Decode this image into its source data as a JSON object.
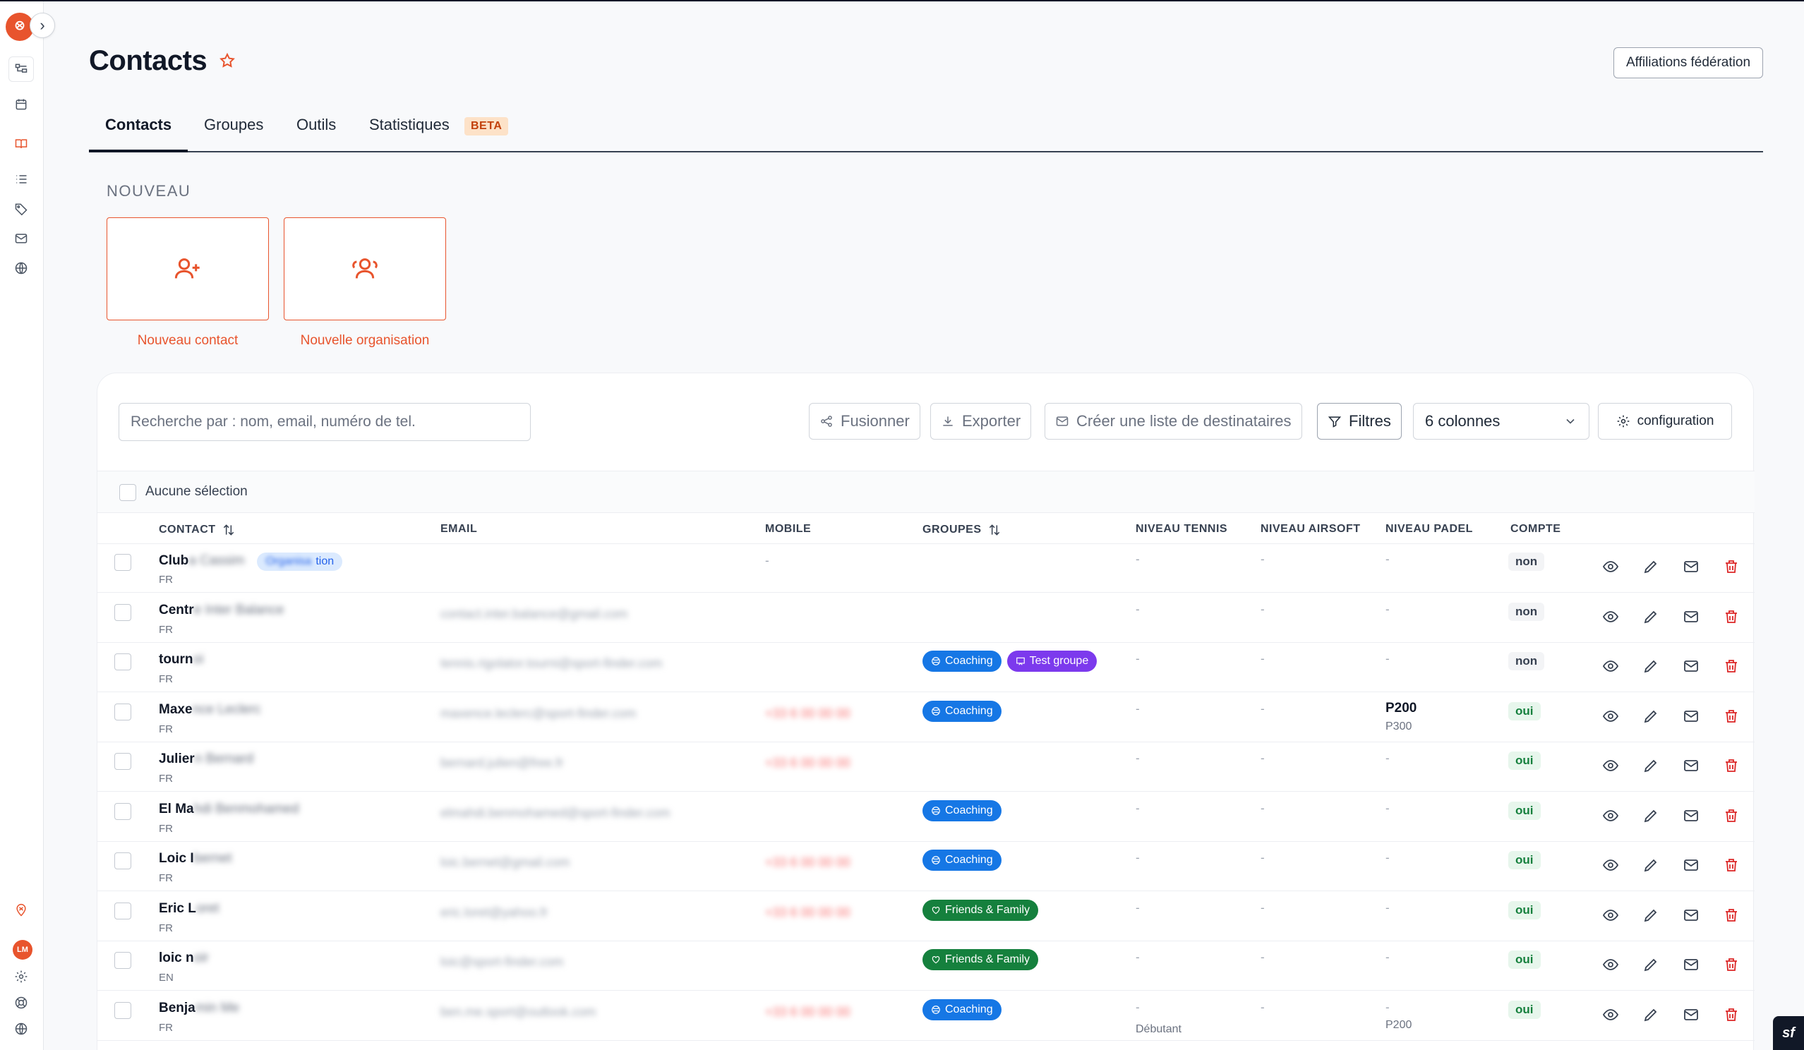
{
  "page": {
    "title": "Contacts",
    "affiliations_button": "Affiliations fédération"
  },
  "user": {
    "initials": "LM"
  },
  "tabs": [
    {
      "label": "Contacts",
      "active": true
    },
    {
      "label": "Groupes"
    },
    {
      "label": "Outils"
    },
    {
      "label": "Statistiques",
      "badge": "BETA"
    }
  ],
  "nouveau": {
    "label": "NOUVEAU",
    "contact_label": "Nouveau contact",
    "organisation_label": "Nouvelle organisation"
  },
  "toolbar": {
    "search_placeholder": "Recherche par : nom, email, numéro de tel.",
    "merge": "Fusionner",
    "export": "Exporter",
    "create_list": "Créer une liste de destinataires",
    "filters": "Filtres",
    "columns_select": "6 colonnes",
    "configuration": "configuration"
  },
  "selection": {
    "label": "Aucune sélection"
  },
  "table": {
    "headers": {
      "contact": "CONTACT",
      "email": "EMAIL",
      "mobile": "MOBILE",
      "groupes": "GROUPES",
      "tennis": "NIVEAU TENNIS",
      "airsoft": "NIVEAU AIRSOFT",
      "padel": "NIVEAU PADEL",
      "compte": "COMPTE"
    },
    "dash": "-",
    "rows": [
      {
        "name": "Club",
        "name_blur": "a Cassim",
        "chip_extra": "tion",
        "lang": "FR",
        "email": "",
        "mobile": "-",
        "groups": [],
        "tennis": "-",
        "airsoft": "-",
        "padel": "-",
        "padel_sub": "",
        "tennis_sub": "",
        "compte": "non"
      },
      {
        "name": "Centr",
        "name_blur": "e Inter Balance",
        "lang": "FR",
        "email": "contact.inter.balance@gmail.com",
        "mobile": "",
        "groups": [],
        "tennis": "-",
        "airsoft": "-",
        "padel": "-",
        "padel_sub": "",
        "tennis_sub": "",
        "compte": "non"
      },
      {
        "name": "tourn",
        "name_blur": "oi",
        "lang": "FR",
        "email": "tennis.rigolator.tourni@sport-finder.com",
        "mobile": "",
        "groups": [
          "Coaching",
          "Test groupe"
        ],
        "tennis": "-",
        "airsoft": "-",
        "padel": "-",
        "padel_sub": "",
        "tennis_sub": "",
        "compte": "non"
      },
      {
        "name": "Maxe",
        "name_blur": "nce Leclerc",
        "lang": "FR",
        "email": "maxence.leclerc@sport-finder.com",
        "mobile": "+33 6 00 00 00",
        "groups": [
          "Coaching"
        ],
        "tennis": "-",
        "airsoft": "-",
        "padel": "P200",
        "padel_sub": "P300",
        "tennis_sub": "",
        "compte": "oui"
      },
      {
        "name": "Julier",
        "name_blur": "n Bernard",
        "lang": "FR",
        "email": "bernard.julien@free.fr",
        "mobile": "+33 6 00 00 00",
        "groups": [],
        "tennis": "-",
        "airsoft": "-",
        "padel": "-",
        "padel_sub": "",
        "tennis_sub": "",
        "compte": "oui"
      },
      {
        "name": "El Ma",
        "name_blur": "hdi Benmohamed",
        "lang": "FR",
        "email": "elmahdi.benmohamed@sport-finder.com",
        "mobile": "",
        "groups": [
          "Coaching"
        ],
        "tennis": "-",
        "airsoft": "-",
        "padel": "-",
        "padel_sub": "",
        "tennis_sub": "",
        "compte": "oui"
      },
      {
        "name": "Loic I",
        "name_blur": "bernet",
        "lang": "FR",
        "email": "loic.bernet@gmail.com",
        "mobile": "+33 6 00 00 00",
        "groups": [
          "Coaching"
        ],
        "tennis": "-",
        "airsoft": "-",
        "padel": "-",
        "padel_sub": "",
        "tennis_sub": "",
        "compte": "oui"
      },
      {
        "name": "Eric L",
        "name_blur": "oret",
        "lang": "FR",
        "email": "eric.loret@yahoo.fr",
        "mobile": "+33 6 00 00 00",
        "groups": [
          "Friends & Family"
        ],
        "tennis": "-",
        "airsoft": "-",
        "padel": "-",
        "padel_sub": "",
        "tennis_sub": "",
        "compte": "oui"
      },
      {
        "name": "loic n",
        "name_blur": "oir",
        "lang": "EN",
        "email": "loic@sport-finder.com",
        "mobile": "",
        "groups": [
          "Friends & Family"
        ],
        "tennis": "-",
        "airsoft": "-",
        "padel": "-",
        "padel_sub": "",
        "tennis_sub": "",
        "compte": "oui"
      },
      {
        "name": "Benja",
        "name_blur": "min Me",
        "lang": "FR",
        "email": "ben.me.sport@outlook.com",
        "mobile": "+33 6 00 00 00",
        "groups": [
          "Coaching"
        ],
        "tennis": "-",
        "airsoft": "-",
        "padel": "-",
        "padel_sub": "P200",
        "tennis_sub": "Débutant",
        "compte": "oui"
      }
    ]
  },
  "colors": {
    "accent": "#e8542d",
    "coaching": "#1677e5",
    "test_groupe": "#7c3aed",
    "friends": "#15803d"
  }
}
